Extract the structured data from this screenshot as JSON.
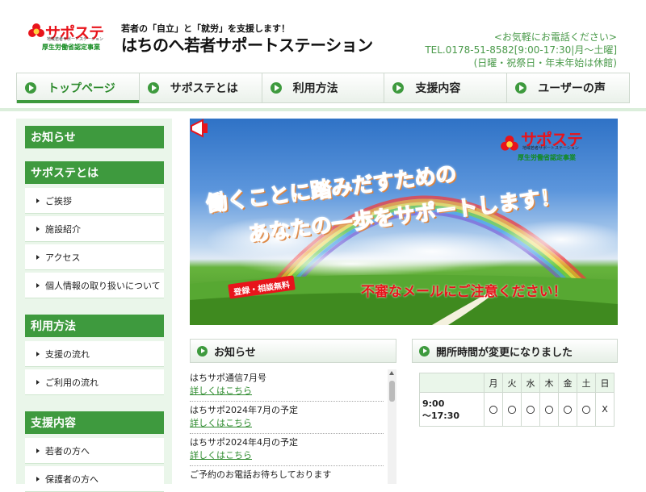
{
  "header": {
    "logo_brand": "サポステ",
    "logo_sub": "地域若者サポートステーション",
    "logo_cert": "厚生労働省認定事業",
    "tagline": "若者の「自立」と「就労」を支援します！",
    "site_name": "はちのへ若者サポートステーション",
    "contact_prompt": "<お気軽にお電話ください>",
    "phone": "TEL.0178-51-8582[9:00-17:30|月〜土曜]",
    "closed": "(日曜・祝祭日・年末年始は休館)"
  },
  "nav": {
    "items": [
      {
        "label": "トップページ"
      },
      {
        "label": "サポステとは"
      },
      {
        "label": "利用方法"
      },
      {
        "label": "支援内容"
      },
      {
        "label": "ユーザーの声"
      }
    ]
  },
  "sidebar": {
    "news": "お知らせ",
    "about": "サポステとは",
    "about_items": [
      "ご挨拶",
      "施設紹介",
      "アクセス",
      "個人情報の取り扱いについて"
    ],
    "usage": "利用方法",
    "usage_items": [
      "支援の流れ",
      "ご利用の流れ"
    ],
    "support": "支援内容",
    "support_items": [
      "若者の方へ",
      "保護者の方へ"
    ]
  },
  "banner": {
    "logo_brand": "サポステ",
    "logo_sub": "地域若者サポートステーション",
    "logo_cert": "厚生労働省認定事業",
    "catch1": "働くことに踏みだすための",
    "catch2": "あなたの一歩をサポートします！",
    "badge": "登録・相談無料",
    "warning": "不審なメールにご注意ください！"
  },
  "news": {
    "title": "お知らせ",
    "entries": [
      {
        "title": "はちサポ通信7月号",
        "link": "詳しくはこちら"
      },
      {
        "title": "はちサポ2024年7月の予定",
        "link": "詳しくはこちら"
      },
      {
        "title": "はちサポ2024年4月の予定",
        "link": "詳しくはこちら"
      },
      {
        "title": "ご予約のお電話お待ちしております",
        "link": ""
      }
    ]
  },
  "hours": {
    "title": "開所時間が変更になりました",
    "days": [
      "月",
      "火",
      "水",
      "木",
      "金",
      "土",
      "日"
    ],
    "time_line1": "9:00",
    "time_line2": "〜17:30",
    "marks": [
      "〇",
      "〇",
      "〇",
      "〇",
      "〇",
      "〇",
      "X"
    ]
  },
  "colors": {
    "accent_green": "#3e9a3e",
    "brand_red": "#e8141b",
    "sidebar_bg": "#eaf6ea"
  }
}
